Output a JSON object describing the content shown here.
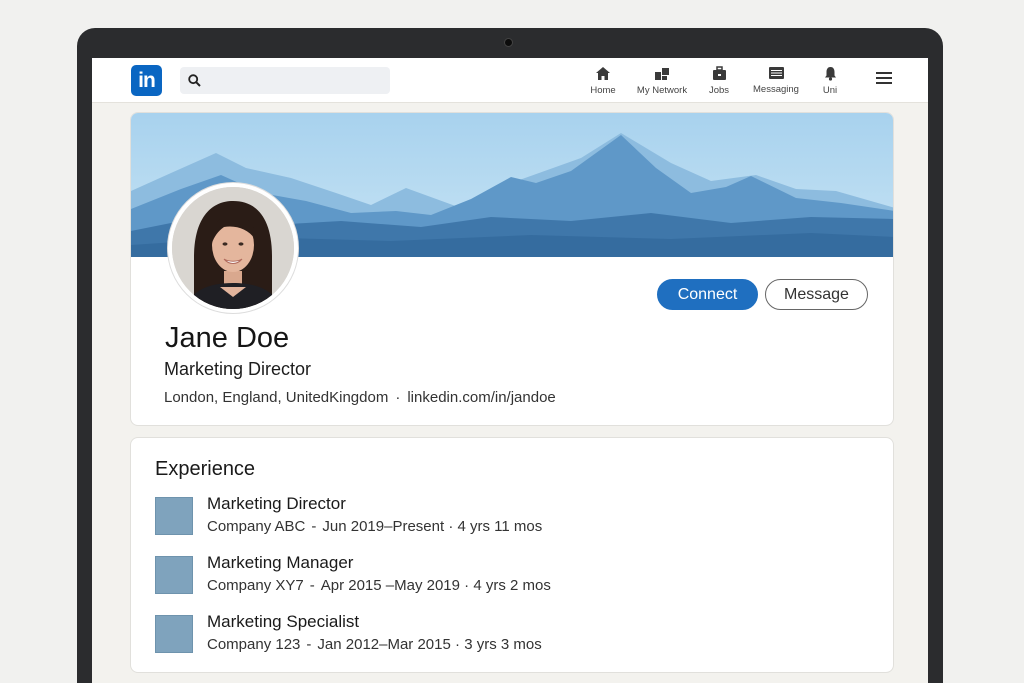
{
  "nav": {
    "logo": "in",
    "search": {
      "placeholder": ""
    },
    "items": [
      {
        "label": "Home",
        "icon": "home-icon"
      },
      {
        "label": "My Network",
        "icon": "network-icon"
      },
      {
        "label": "Jobs",
        "icon": "briefcase-icon"
      },
      {
        "label": "Messaging",
        "icon": "messaging-icon"
      },
      {
        "label": "Uni",
        "icon": "bell-icon"
      }
    ],
    "menu_icon": "hamburger-icon"
  },
  "profile": {
    "name": "Jane Doe",
    "headline": "Marketing Director",
    "location": "London, England, UnitedKingdom",
    "separator": "·",
    "url": "linkedin.com/in/jandoe",
    "connect_label": "Connect",
    "message_label": "Message"
  },
  "experience": {
    "title": "Experience",
    "items": [
      {
        "role": "Marketing Director",
        "company": "Company ABC",
        "dash": "-",
        "dates": "Jun 2019–Present",
        "duration": "4 yrs 11 mos"
      },
      {
        "role": "Marketing Manager",
        "company": "Company XY7",
        "dash": "-",
        "dates": "Apr 2015 –May 2019",
        "duration": "4 yrs 2 mos"
      },
      {
        "role": "Marketing Specialist",
        "company": "Company 123",
        "dash": "-",
        "dates": "Jan 2012–Mar 2015",
        "duration": "3 yrs 3 mos"
      }
    ]
  },
  "colors": {
    "brand": "#0a66c2",
    "connect_button": "#1f6fc0",
    "cover_sky": "#a9d3ee",
    "company_logo": "#7fa3bd"
  }
}
